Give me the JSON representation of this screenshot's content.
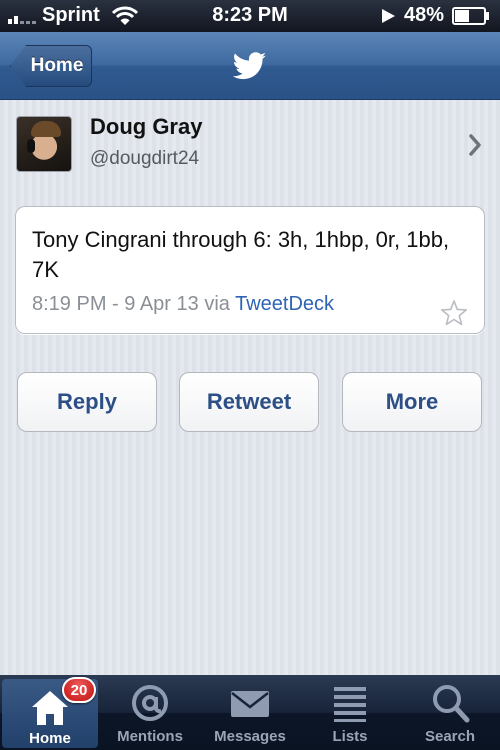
{
  "status_bar": {
    "carrier": "Sprint",
    "time": "8:23 PM",
    "battery": "48%",
    "icons": [
      "signal-icon",
      "wifi-icon",
      "location-icon",
      "battery-icon"
    ]
  },
  "nav": {
    "back_label": "Home",
    "logo": "twitter-bird-icon",
    "accent_color": "#3f6aa0"
  },
  "profile": {
    "name": "Doug Gray",
    "handle": "@dougdirt24"
  },
  "tweet": {
    "text": "Tony Cingrani through 6: 3h, 1hbp, 0r, 1bb, 7K",
    "timestamp": "8:19 PM - 9 Apr 13",
    "via_prefix": "via",
    "via_app": "TweetDeck",
    "link_color": "#2e64b3"
  },
  "actions": {
    "reply": "Reply",
    "retweet": "Retweet",
    "more": "More"
  },
  "tab_bar": {
    "badge": "20",
    "tabs": [
      {
        "label": "Home",
        "icon": "home-icon",
        "active": true
      },
      {
        "label": "Mentions",
        "icon": "at-icon",
        "active": false
      },
      {
        "label": "Messages",
        "icon": "envelope-icon",
        "active": false
      },
      {
        "label": "Lists",
        "icon": "list-icon",
        "active": false
      },
      {
        "label": "Search",
        "icon": "search-icon",
        "active": false
      }
    ]
  }
}
